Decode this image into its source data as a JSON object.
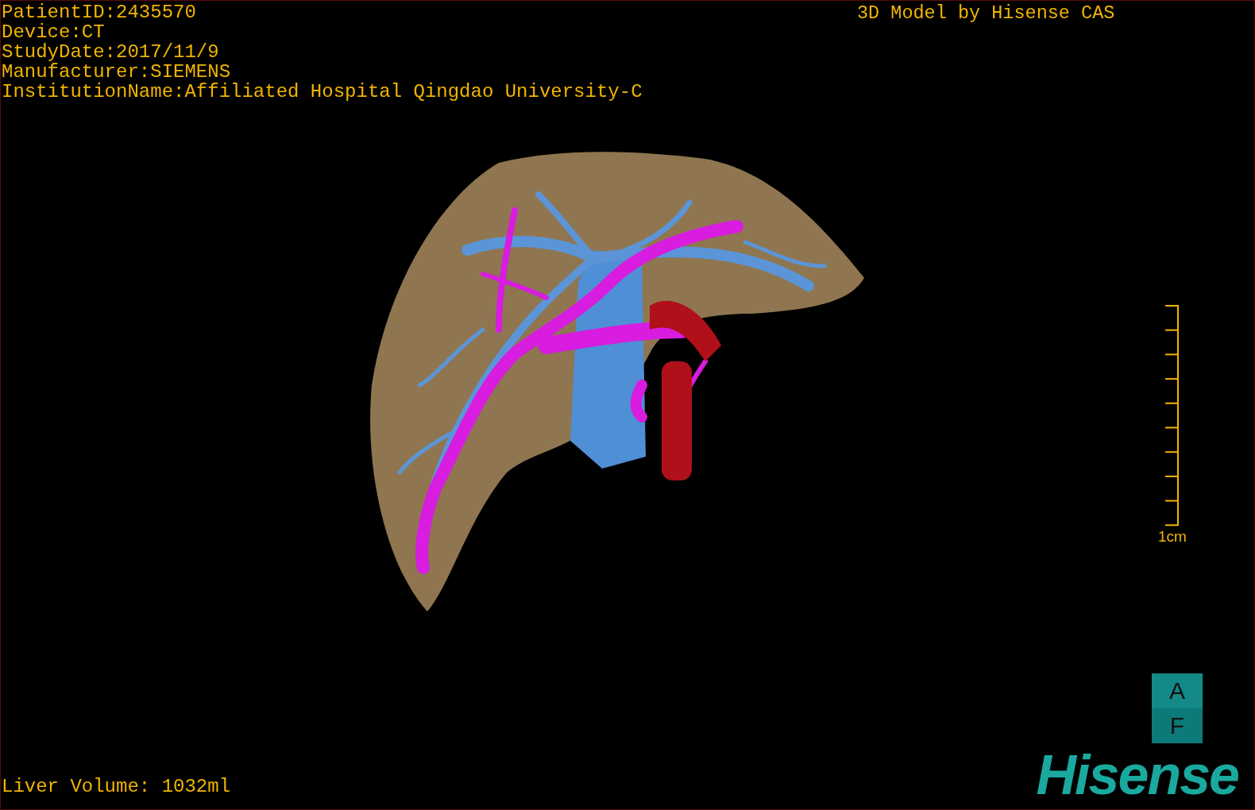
{
  "patient_info": [
    "PatientID:2435570",
    "Device:CT",
    "StudyDate:2017/11/9",
    "Manufacturer:SIEMENS",
    "InstitutionName:Affiliated Hospital Qingdao University-C"
  ],
  "title": "3D Model by Hisense CAS",
  "scale_bar": {
    "label": "1cm"
  },
  "liver_volume": "Liver Volume: 1032ml",
  "orientation_marker": [
    "A",
    "F"
  ],
  "logo": "Hisense"
}
